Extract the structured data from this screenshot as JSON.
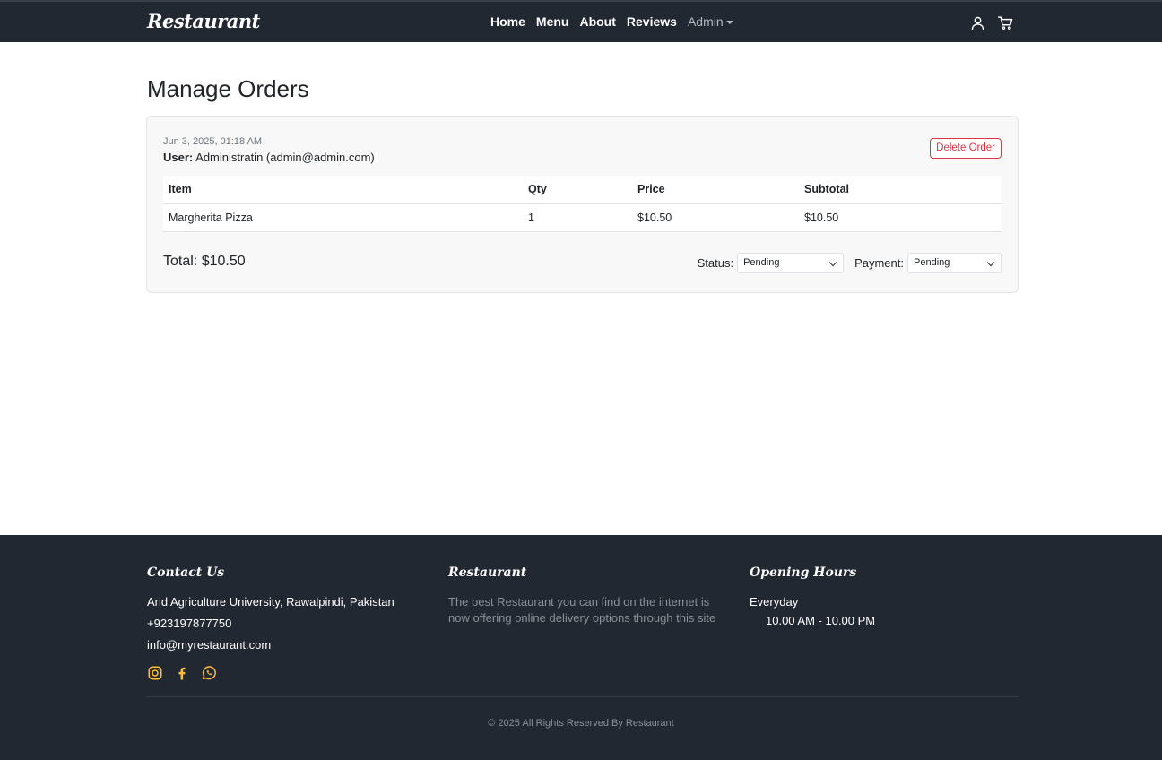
{
  "navbar": {
    "brand": "Restaurant",
    "links": [
      "Home",
      "Menu",
      "About",
      "Reviews"
    ],
    "admin_label": "Admin"
  },
  "page": {
    "title": "Manage Orders"
  },
  "order": {
    "date": "Jun 3, 2025, 01:18 AM",
    "user_label": "User:",
    "user_value": "Administratin (admin@admin.com)",
    "delete_label": "Delete Order",
    "columns": [
      "Item",
      "Qty",
      "Price",
      "Subtotal"
    ],
    "rows": [
      [
        "Margherita Pizza",
        "1",
        "$10.50",
        "$10.50"
      ]
    ],
    "total": "Total: $10.50",
    "status_label": "Status:",
    "status_value": "Pending",
    "payment_label": "Payment:",
    "payment_value": "Pending"
  },
  "footer": {
    "contact_heading": "Contact Us",
    "address": "Arid Agriculture University, Rawalpindi, Pakistan",
    "phone": "+923197877750",
    "email": "info@myrestaurant.com",
    "about_heading": "Restaurant",
    "about_line1": "The best Restaurant you can find on the internet is",
    "about_line2": "now offering online delivery options through this site",
    "hours_heading": "Opening Hours",
    "hours_day": "Everyday",
    "hours_time": "10.00 AM - 10.00 PM",
    "copyright": "© 2025 All Rights Reserved By Restaurant"
  },
  "icons": {
    "user": "user-icon",
    "cart": "cart-icon",
    "instagram": "instagram-icon",
    "facebook": "facebook-icon",
    "whatsapp": "whatsapp-icon"
  },
  "colors": {
    "navbar_bg": "#222831",
    "accent_yellow": "#ffbe33",
    "danger": "#dc3545"
  }
}
